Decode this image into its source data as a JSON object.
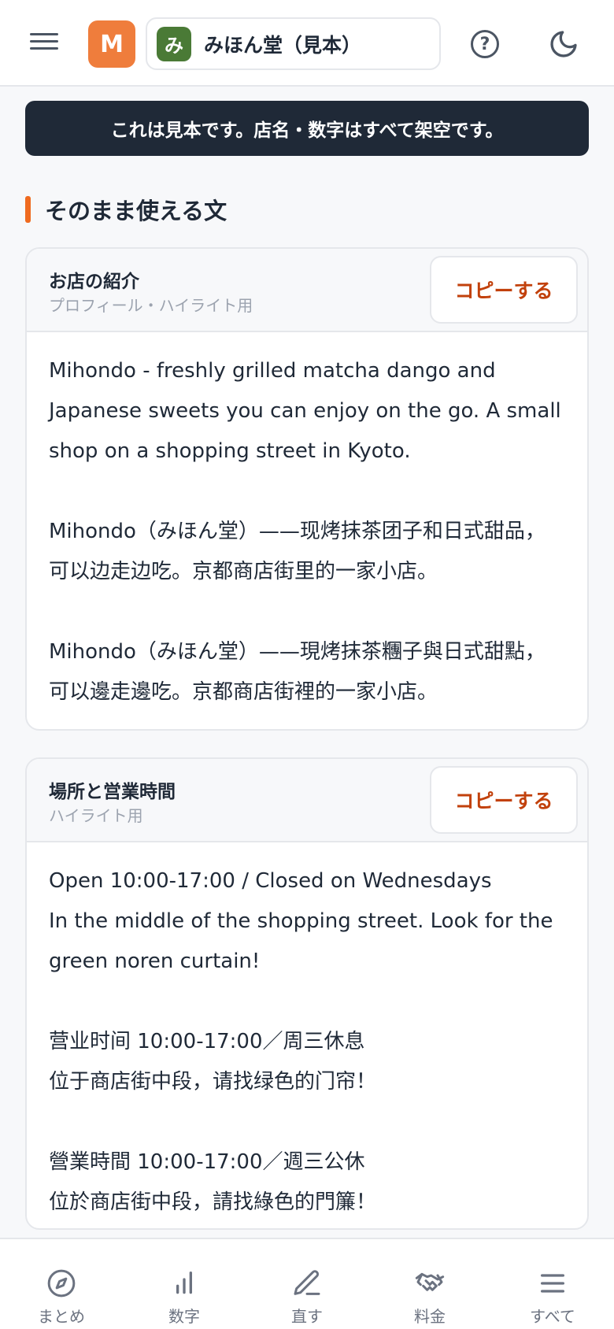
{
  "header": {
    "avatar_letter": "M",
    "shop_badge": "み",
    "shop_name": "みほん堂（見本）",
    "help_glyph": "?"
  },
  "notice": "これは見本です。店名・数字はすべて架空です。",
  "section_title": "そのまま使える文",
  "cards": [
    {
      "title": "お店の紹介",
      "subtitle": "プロフィール・ハイライト用",
      "copy_label": "コピーする",
      "body": "Mihondo - freshly grilled matcha dango and Japanese sweets you can enjoy on the go. A small shop on a shopping street in Kyoto.\n\nMihondo（みほん堂）——现烤抹茶团子和日式甜品，可以边走边吃。京都商店街里的一家小店。\n\nMihondo（みほん堂）——現烤抹茶糰子與日式甜點，可以邊走邊吃。京都商店街裡的一家小店。"
    },
    {
      "title": "場所と営業時間",
      "subtitle": "ハイライト用",
      "copy_label": "コピーする",
      "body": "Open 10:00-17:00 / Closed on Wednesdays\nIn the middle of the shopping street. Look for the green noren curtain!\n\n营业时间 10:00-17:00／周三休息\n位于商店街中段，请找绿色的门帘！\n\n營業時間 10:00-17:00／週三公休\n位於商店街中段，請找綠色的門簾！"
    }
  ],
  "bottom_nav": [
    {
      "label": "まとめ",
      "icon": "compass-icon"
    },
    {
      "label": "数字",
      "icon": "bar-chart-icon"
    },
    {
      "label": "直す",
      "icon": "pencil-icon"
    },
    {
      "label": "料金",
      "icon": "handshake-icon"
    },
    {
      "label": "すべて",
      "icon": "menu-icon"
    }
  ],
  "colors": {
    "accent": "#ef7d3c",
    "copy_text": "#c2410c",
    "shop_badge": "#4a7a36",
    "banner": "#1f2937"
  }
}
